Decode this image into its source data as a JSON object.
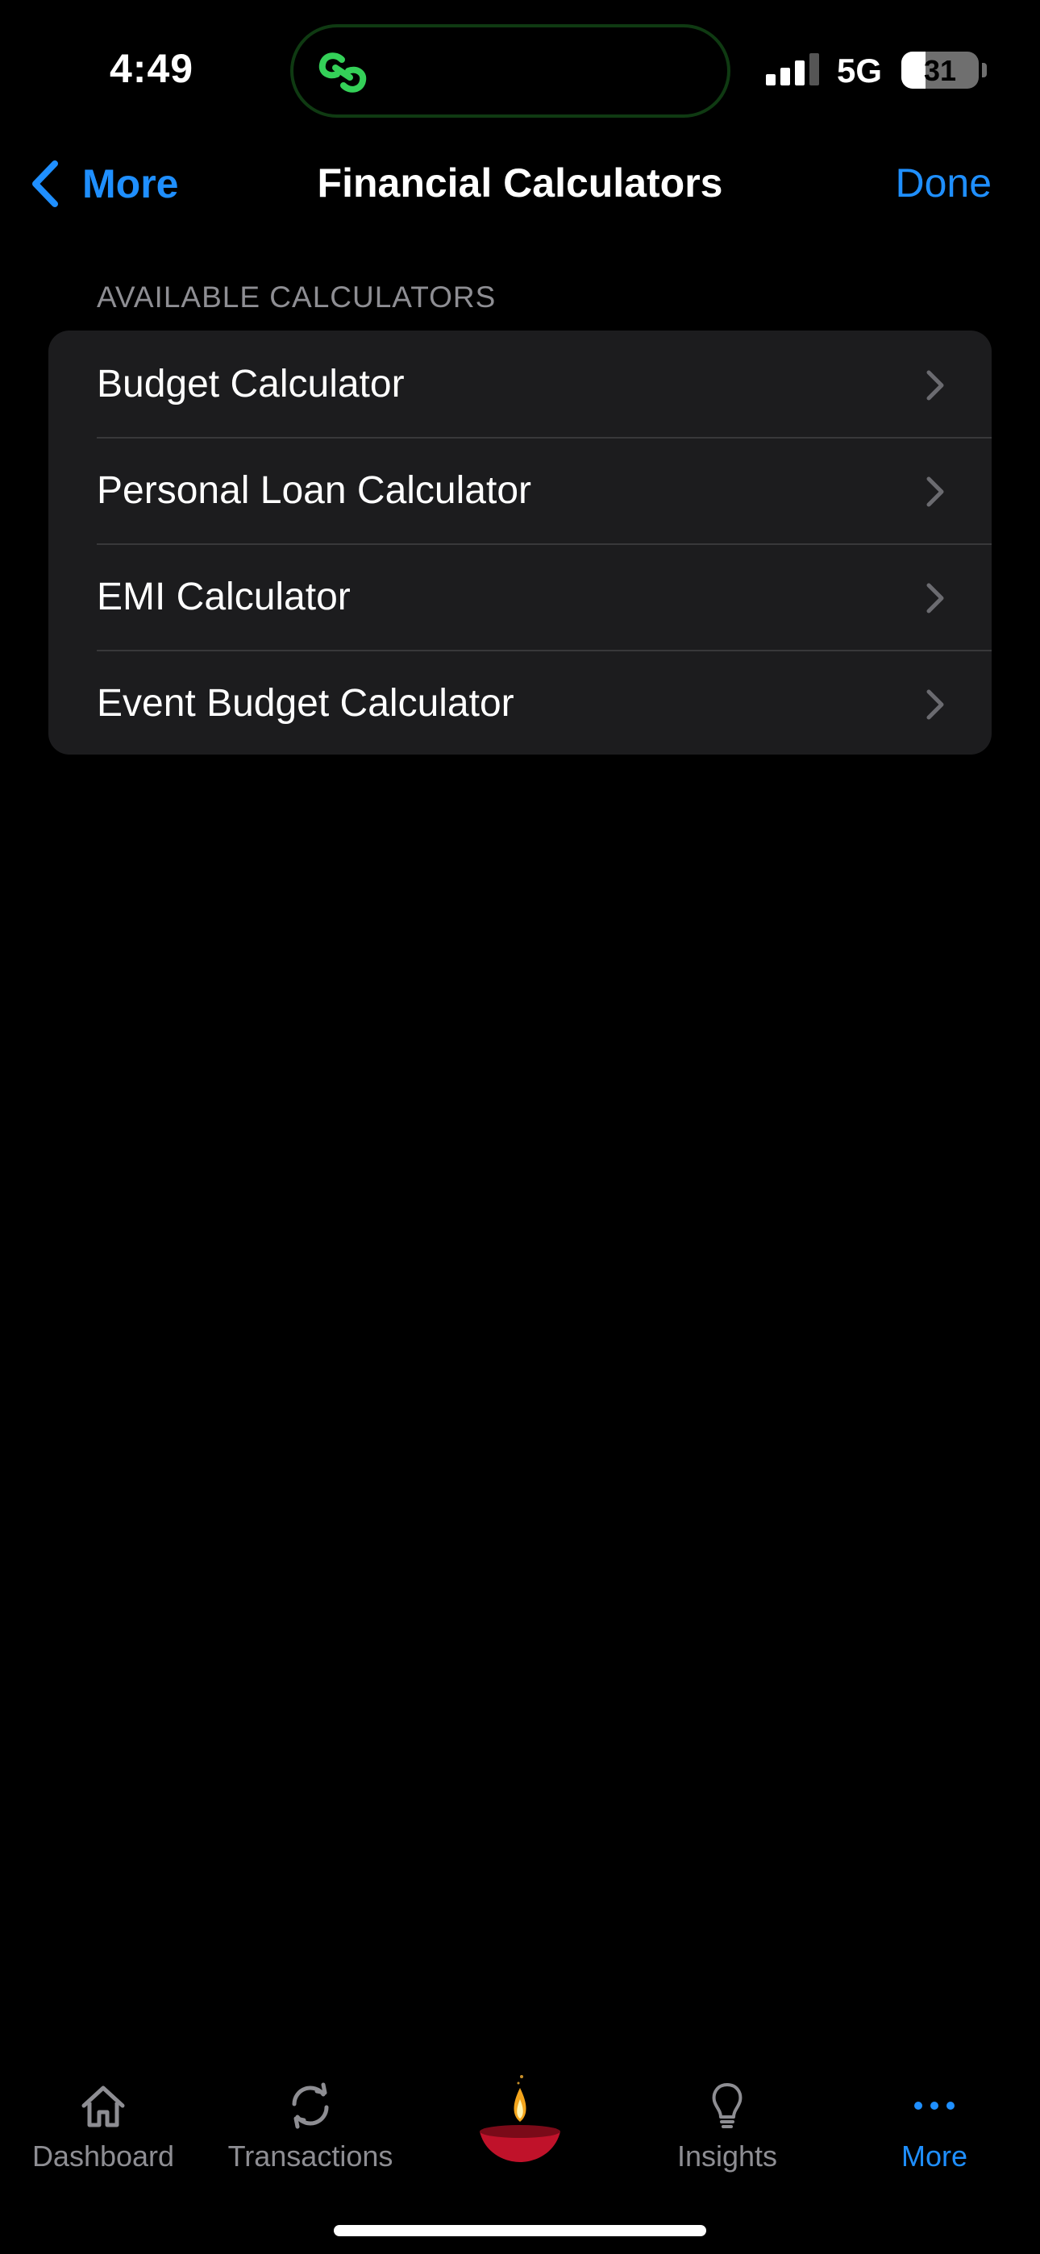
{
  "status_bar": {
    "time": "4:49",
    "network": "5G",
    "battery": "31",
    "battery_level": 0.31,
    "island_icon": "link-chain-icon"
  },
  "nav": {
    "back_label": "More",
    "title": "Financial Calculators",
    "done_label": "Done"
  },
  "section": {
    "header": "AVAILABLE CALCULATORS",
    "items": [
      {
        "label": "Budget Calculator"
      },
      {
        "label": "Personal Loan Calculator"
      },
      {
        "label": "EMI Calculator"
      },
      {
        "label": "Event Budget Calculator"
      }
    ]
  },
  "tab_bar": {
    "tabs": [
      {
        "label": "Dashboard",
        "icon": "house-icon"
      },
      {
        "label": "Transactions",
        "icon": "sync-arrows-icon"
      },
      {
        "label": "",
        "icon": "diya-lamp-icon"
      },
      {
        "label": "Insights",
        "icon": "lightbulb-icon"
      },
      {
        "label": "More",
        "icon": "ellipsis-icon",
        "active": true
      }
    ]
  },
  "colors": {
    "accent": "#1f8fff",
    "background": "#000000",
    "card": "#1c1c1e",
    "secondary_text": "#8e8e93",
    "island_green": "#34d058"
  }
}
